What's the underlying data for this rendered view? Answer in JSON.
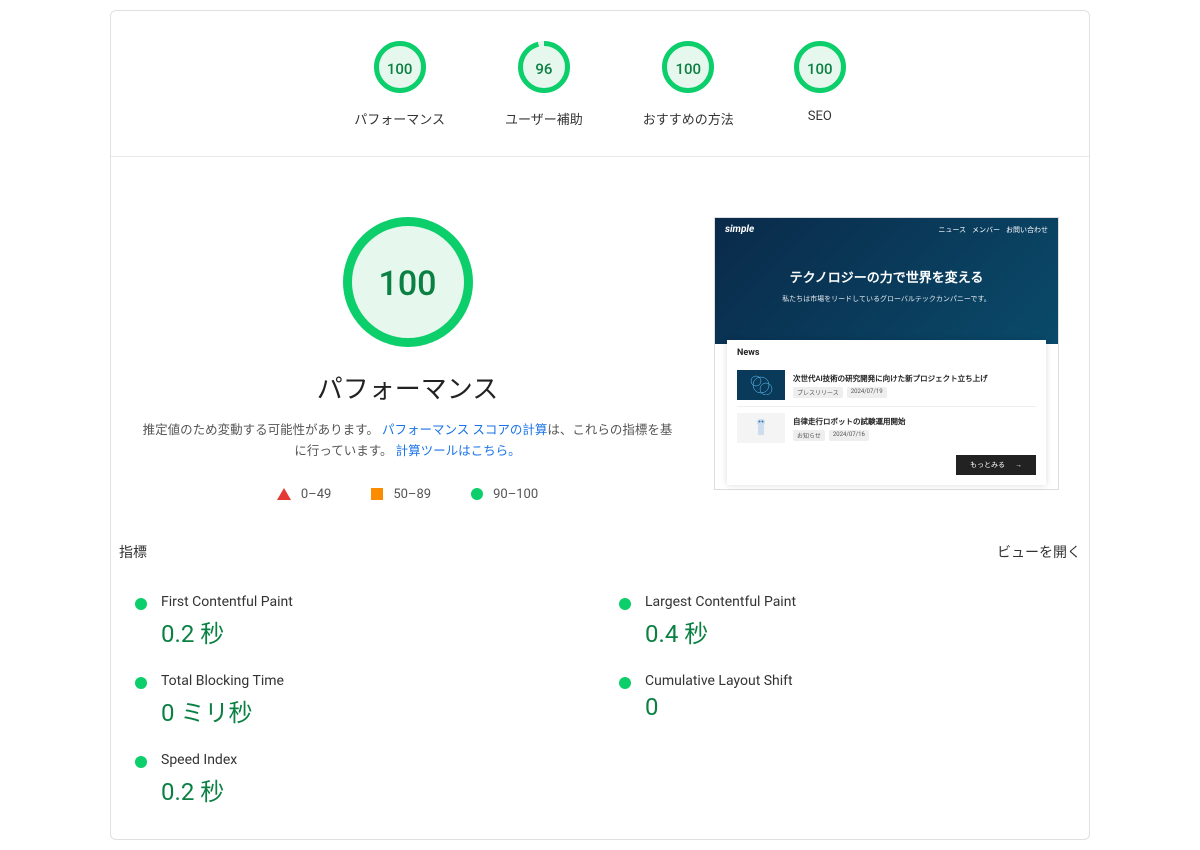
{
  "topGauges": [
    {
      "score": 100,
      "label": "パフォーマンス",
      "color": "#0cce6b"
    },
    {
      "score": 96,
      "label": "ユーザー補助",
      "color": "#0cce6b"
    },
    {
      "score": 100,
      "label": "おすすめの方法",
      "color": "#0cce6b"
    },
    {
      "score": 100,
      "label": "SEO",
      "color": "#0cce6b"
    }
  ],
  "bigGauge": {
    "score": 100,
    "label": "パフォーマンス",
    "color": "#0cce6b"
  },
  "description": {
    "prefix": "推定値のため変動する可能性があります。",
    "link1": "パフォーマンス スコアの計算",
    "middle": "は、これらの指標を基に行っています。",
    "link2": "計算ツールはこちら。"
  },
  "legend": {
    "fail": "0–49",
    "avg": "50–89",
    "pass": "90–100"
  },
  "screenshot": {
    "logo": "simple",
    "nav": [
      "ニュース",
      "メンバー",
      "お問い合わせ"
    ],
    "headline": "テクノロジーの力で世界を変える",
    "sub": "私たちは市場をリードしているグローバルテックカンパニーです。",
    "newsTitle": "News",
    "items": [
      {
        "title": "次世代AI技術の研究開発に向けた新プロジェクト立ち上げ",
        "tag1": "プレスリリース",
        "tag2": "2024/07/19"
      },
      {
        "title": "自律走行ロボットの試験運用開始",
        "tag1": "お知らせ",
        "tag2": "2024/07/16"
      }
    ],
    "more": "もっとみる"
  },
  "metricsHeader": {
    "left": "指標",
    "right": "ビューを開く"
  },
  "metrics": [
    {
      "name": "First Contentful Paint",
      "value": "0.2 秒"
    },
    {
      "name": "Largest Contentful Paint",
      "value": "0.4 秒"
    },
    {
      "name": "Total Blocking Time",
      "value": "0 ミリ秒"
    },
    {
      "name": "Cumulative Layout Shift",
      "value": "0"
    },
    {
      "name": "Speed Index",
      "value": "0.2 秒"
    }
  ]
}
